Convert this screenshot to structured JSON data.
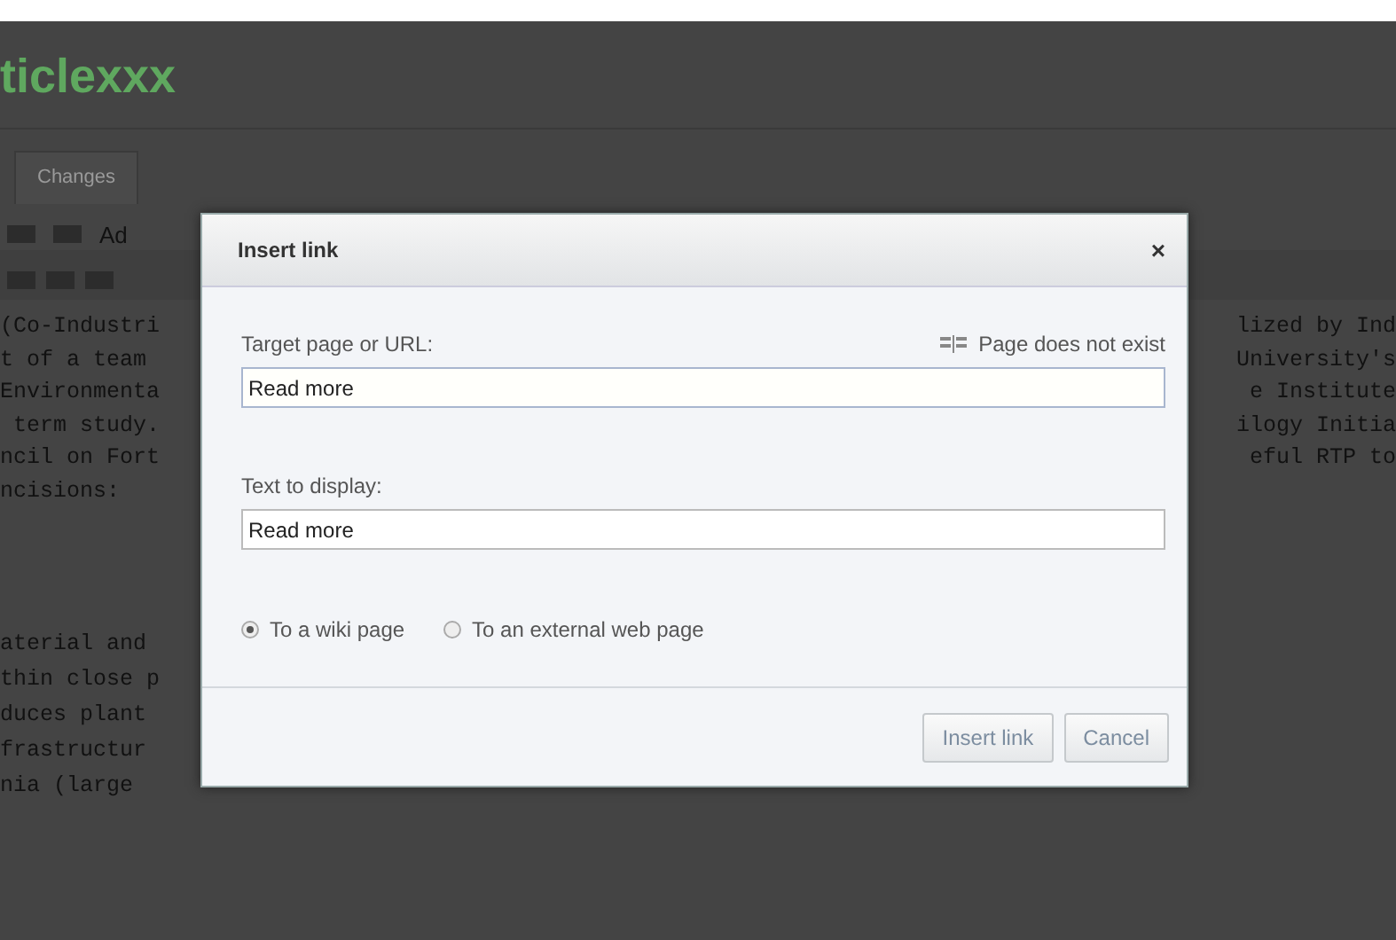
{
  "page": {
    "title": "ticlexxx",
    "tabs": [
      {
        "label": "Changes"
      }
    ],
    "toolbar_text": "Ad",
    "text_groups": [
      [
        {
          "left": "(Co-Industri",
          "right": "lized by Ind"
        },
        {
          "left": "t of a team",
          "right": "University's"
        },
        {
          "left": "Environmenta",
          "right": "e Institute"
        },
        {
          "left": " term study.",
          "right": "ilogy Initia"
        },
        {
          "left": "ncil on Fort",
          "right": "eful RTP to"
        },
        {
          "left": "ncisions:"
        }
      ],
      [
        {
          "left": "aterial and"
        },
        {
          "left": "thin close p"
        },
        {
          "left": "duces plant"
        },
        {
          "left": "frastructur"
        },
        {
          "left": "nia (large"
        }
      ]
    ]
  },
  "dialog": {
    "title": "Insert link",
    "close": "×",
    "target_label": "Target page or URL:",
    "target_status": "Page does not exist",
    "target_value": "Read more",
    "text_label": "Text to display:",
    "text_value": "Read more",
    "radios": [
      {
        "label": "To a wiki page",
        "selected": true
      },
      {
        "label": "To an external web page",
        "selected": false
      }
    ],
    "buttons": [
      "Insert link",
      "Cancel"
    ]
  }
}
